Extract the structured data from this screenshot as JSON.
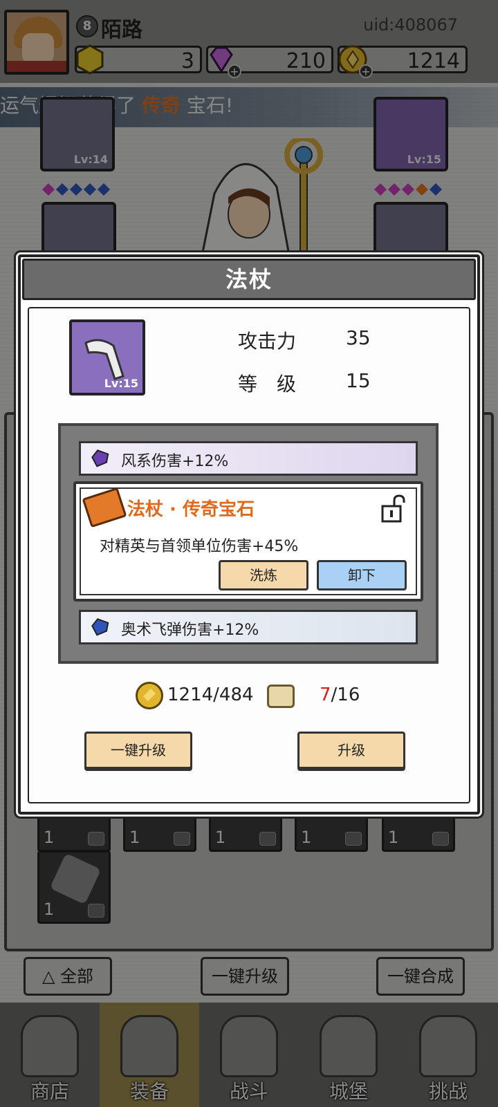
{
  "player": {
    "level": "8",
    "name": "陌路",
    "uid": "uid:408067"
  },
  "resources": [
    {
      "name": "hexagon-gem",
      "value": "3",
      "color": "#e6c82a"
    },
    {
      "name": "diamond",
      "value": "210",
      "color": "#c06ad8"
    },
    {
      "name": "gold-coin",
      "value": "1214",
      "color": "#e2b52e"
    }
  ],
  "announcement": {
    "prefix": "运气爆棚获得了",
    "highlight": "传奇",
    "suffix": "宝石!"
  },
  "equipment": {
    "left_top_level": "Lv:14",
    "right_top_level": "Lv:15"
  },
  "modal": {
    "title": "法杖",
    "item_level": "Lv:15",
    "stats": [
      {
        "label": "攻击力",
        "value": "35"
      },
      {
        "label": "等　级",
        "value": "15"
      }
    ],
    "gems": {
      "top": {
        "text": "风系伤害+12%",
        "color": "#6a3fb0"
      },
      "legend": {
        "title": "法杖 · 传奇宝石",
        "desc": "对精英与首领单位伤害+45%",
        "refine_label": "洗炼",
        "unequip_label": "卸下",
        "color": "#e06a1c"
      },
      "bottom": {
        "text": "奥术飞弹伤害+12%",
        "color": "#2f55b8"
      }
    },
    "cost": {
      "gold": "1214/484",
      "scroll_have": "7",
      "scroll_need": "/16"
    },
    "buttons": {
      "upgrade_all": "一键升级",
      "upgrade": "升级"
    }
  },
  "inventory": {
    "counts": [
      "1",
      "1",
      "1",
      "1",
      "1",
      "1"
    ]
  },
  "bottom_buttons": {
    "filter": "全部",
    "upgrade_all": "一键升级",
    "merge_all": "一键合成"
  },
  "tabs": [
    {
      "label": "商店"
    },
    {
      "label": "装备"
    },
    {
      "label": "战斗"
    },
    {
      "label": "城堡"
    },
    {
      "label": "挑战"
    }
  ]
}
